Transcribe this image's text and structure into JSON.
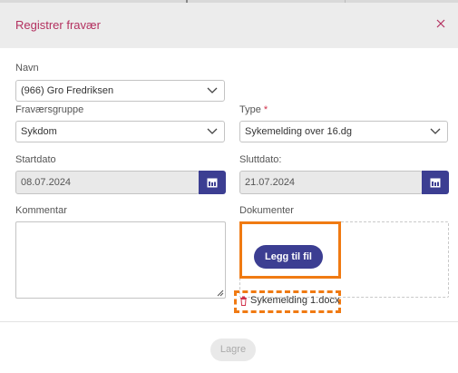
{
  "modal": {
    "title": "Registrer fravær",
    "close_icon": "close-icon"
  },
  "form": {
    "name": {
      "label": "Navn",
      "value": "(966) Gro Fredriksen"
    },
    "absence_group": {
      "label": "Fraværsgruppe",
      "value": "Sykdom"
    },
    "type": {
      "label": "Type",
      "required_marker": "*",
      "value": "Sykemelding over 16.dg"
    },
    "start_date": {
      "label": "Startdato",
      "value": "08.07.2024"
    },
    "end_date": {
      "label": "Sluttdato:",
      "value": "21.07.2024"
    },
    "comment": {
      "label": "Kommentar",
      "value": ""
    },
    "documents": {
      "label": "Dokumenter",
      "add_button": "Legg til fil",
      "files": [
        {
          "name": "Sykemelding 1.docx"
        }
      ]
    }
  },
  "footer": {
    "save_label": "Lagre"
  },
  "colors": {
    "title": "#b3305f",
    "accent": "#3c3e92",
    "highlight": "#f07a12"
  }
}
